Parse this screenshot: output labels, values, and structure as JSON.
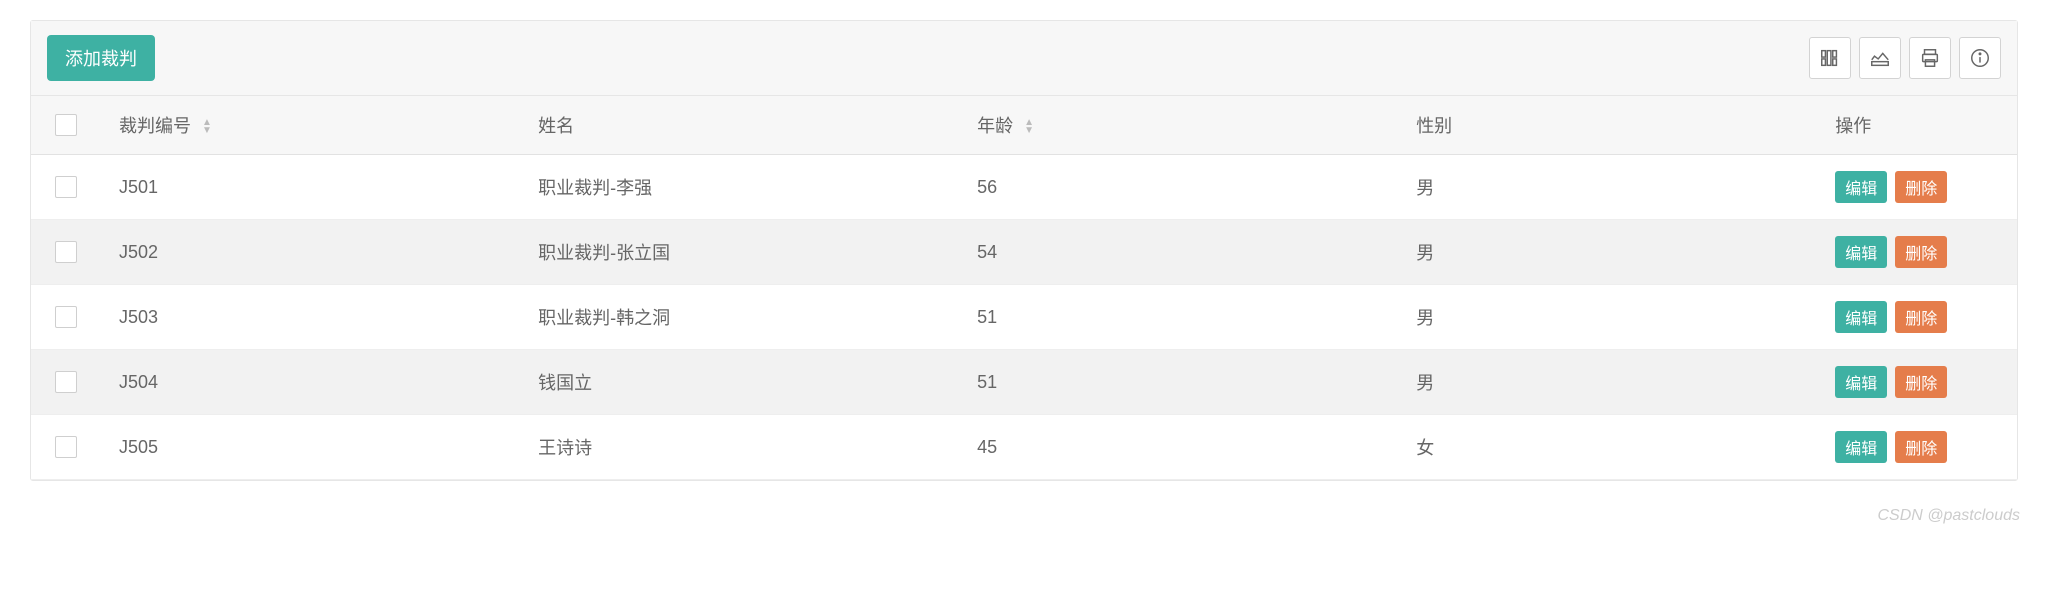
{
  "toolbar": {
    "add_label": "添加裁判"
  },
  "headers": {
    "id": "裁判编号",
    "name": "姓名",
    "age": "年龄",
    "gender": "性别",
    "op": "操作"
  },
  "actions": {
    "edit": "编辑",
    "delete": "删除"
  },
  "rows": [
    {
      "id": "J501",
      "name": "职业裁判-李强",
      "age": "56",
      "gender": "男"
    },
    {
      "id": "J502",
      "name": "职业裁判-张立国",
      "age": "54",
      "gender": "男"
    },
    {
      "id": "J503",
      "name": "职业裁判-韩之洞",
      "age": "51",
      "gender": "男"
    },
    {
      "id": "J504",
      "name": "钱国立",
      "age": "51",
      "gender": "男"
    },
    {
      "id": "J505",
      "name": "王诗诗",
      "age": "45",
      "gender": "女"
    }
  ],
  "watermark": "CSDN @pastclouds"
}
